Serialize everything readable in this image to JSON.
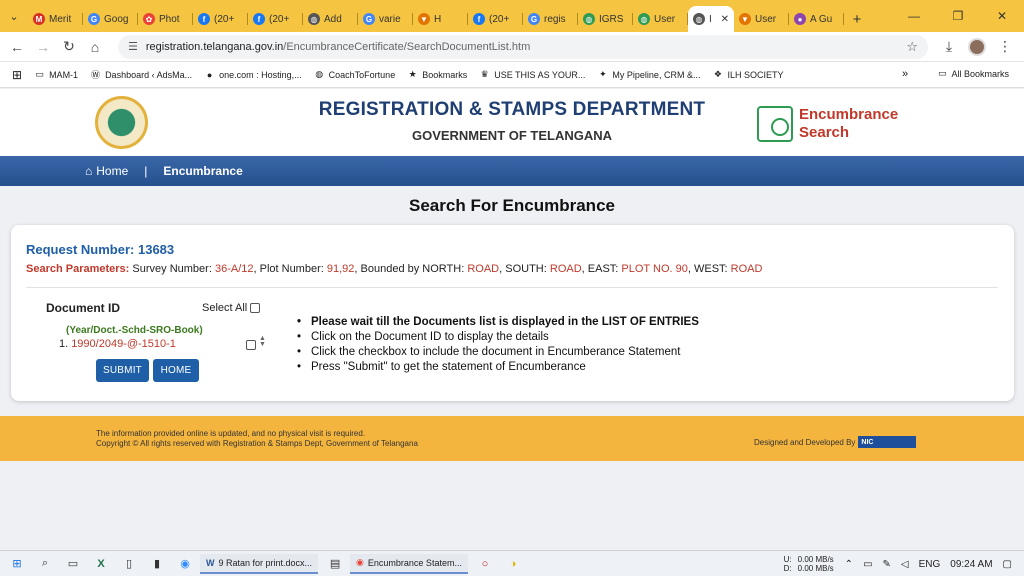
{
  "browser": {
    "tabs": [
      {
        "label": "Merit",
        "icon": "gmail-icon",
        "color": "#d93025",
        "glyph": "M"
      },
      {
        "label": "Goog",
        "icon": "google-icon",
        "color": "#4285f4",
        "glyph": "G"
      },
      {
        "label": "Phot",
        "icon": "photos-icon",
        "color": "#ea4335",
        "glyph": "✿"
      },
      {
        "label": "(20+",
        "icon": "facebook-icon",
        "color": "#1877f2",
        "glyph": "f"
      },
      {
        "label": "(20+",
        "icon": "facebook-icon",
        "color": "#1877f2",
        "glyph": "f"
      },
      {
        "label": "Add",
        "icon": "globe-icon",
        "color": "#555555",
        "glyph": "◍"
      },
      {
        "label": "varie",
        "icon": "google-icon",
        "color": "#4285f4",
        "glyph": "G"
      },
      {
        "label": "H",
        "icon": "web-icon",
        "color": "#e37400",
        "glyph": "▼"
      },
      {
        "label": "(20+",
        "icon": "facebook-icon",
        "color": "#1877f2",
        "glyph": "f"
      },
      {
        "label": "regis",
        "icon": "google-icon",
        "color": "#4285f4",
        "glyph": "G"
      },
      {
        "label": "IGRS",
        "icon": "globe-icon",
        "color": "#2e9b52",
        "glyph": "◍"
      },
      {
        "label": "User",
        "icon": "globe-icon",
        "color": "#2e9b52",
        "glyph": "◍"
      },
      {
        "label": "I",
        "icon": "globe-icon",
        "color": "#555555",
        "glyph": "◍",
        "active": true
      },
      {
        "label": "User",
        "icon": "web-icon",
        "color": "#e37400",
        "glyph": "▼"
      },
      {
        "label": "A Gu",
        "icon": "web-icon",
        "color": "#8e44ad",
        "glyph": "●"
      }
    ],
    "url_host": "registration.telangana.gov.in",
    "url_path": "/EncumbranceCertificate/SearchDocumentList.htm",
    "bookmarks": [
      {
        "label": "MAM-1",
        "icon": "folder-icon",
        "glyph": "▭"
      },
      {
        "label": "Dashboard ‹ AdsMa...",
        "icon": "wordpress-icon",
        "glyph": "Ⓦ"
      },
      {
        "label": "one.com : Hosting,...",
        "icon": "onecom-icon",
        "glyph": "●"
      },
      {
        "label": "CoachToFortune",
        "icon": "globe-icon",
        "glyph": "◍"
      },
      {
        "label": "Bookmarks",
        "icon": "star-icon",
        "glyph": "★"
      },
      {
        "label": "USE THIS AS YOUR...",
        "icon": "crown-icon",
        "glyph": "♛"
      },
      {
        "label": "My Pipeline, CRM &...",
        "icon": "pipeline-icon",
        "glyph": "✦"
      },
      {
        "label": "ILH SOCIETY",
        "icon": "society-icon",
        "glyph": "❖"
      }
    ],
    "all_bookmarks": "All Bookmarks"
  },
  "header": {
    "title": "REGISTRATION & STAMPS DEPARTMENT",
    "subtitle": "GOVERNMENT OF TELANGANA",
    "enc_line1": "Encumbrance",
    "enc_line2": "Search"
  },
  "nav": {
    "home": "Home",
    "separator": "|",
    "encumbrance": "Encumbrance"
  },
  "main": {
    "page_title": "Search For Encumbrance",
    "request_label": "Request Number:",
    "request_number": "13683",
    "params_label": "Search Parameters:",
    "survey_label": "Survey Number:",
    "survey_value": "36-A/12",
    "plot_label": "Plot Number:",
    "plot_value": "91,92",
    "north_label": "Bounded by NORTH:",
    "north_value": "ROAD",
    "south_label": "SOUTH:",
    "south_value": "ROAD",
    "east_label": "EAST:",
    "east_value": "PLOT NO. 90",
    "west_label": "WEST:",
    "west_value": "ROAD",
    "doc_id_header": "Document ID",
    "select_all": "Select All",
    "doc_format": "(Year/Doct.-Schd-SRO-Book)",
    "documents": [
      {
        "index": "1.",
        "id": "1990/2049-@-1510-1",
        "checked": false
      }
    ],
    "submit_label": "SUBMIT",
    "home_label": "HOME",
    "instructions": [
      "Please wait till the Documents list is displayed in the LIST OF ENTRIES",
      "Click on the Document ID to display the details",
      "Click the checkbox to include the document in Encumberance Statement",
      "Press \"Submit\" to get the statement of Encumberance"
    ]
  },
  "footer": {
    "line1": "The information provided online is updated, and no physical visit is required.",
    "line2": "Copyright © All rights reserved with Registration & Stamps Dept, Government of Telangana",
    "designed": "Designed and Developed By",
    "nic": "NIC"
  },
  "taskbar": {
    "task1": "9 Ratan for print.docx...",
    "task2": "Encumbrance Statem...",
    "up_label": "U:",
    "up_value": "0.00 MB/s",
    "down_label": "D:",
    "down_value": "0.00 MB/s",
    "lang": "ENG",
    "time": "09:24 AM"
  }
}
